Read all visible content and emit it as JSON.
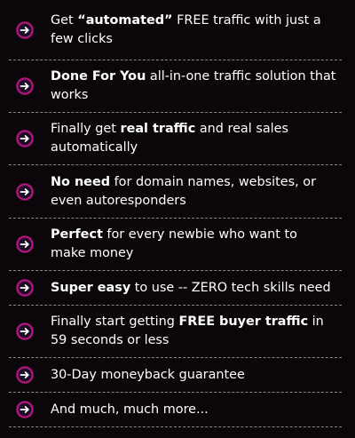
{
  "colors": {
    "background": "#0b0609",
    "text": "#ffffff",
    "bullet_ring": "#b0147c",
    "bullet_fill": "#1c0d24",
    "divider": "#8a8587"
  },
  "bullet_icon": "arrow-right-icon",
  "items": [
    {
      "pre": "Get ",
      "bold": "“automated”",
      "post": " FREE traffic with just a few clicks"
    },
    {
      "pre": "",
      "bold": " Done For You",
      "post": " all-in-one traffic solution that works"
    },
    {
      "pre": "Finally get ",
      "bold": "real traffic",
      "post": " and real sales automatically"
    },
    {
      "pre": "",
      "bold": "No need",
      "post": " for domain names, websites, or even autoresponders"
    },
    {
      "pre": "",
      "bold": "Perfect",
      "post": " for every newbie who want to make money"
    },
    {
      "pre": "",
      "bold": "Super easy",
      "post": " to use -- ZERO tech skills need"
    },
    {
      "pre": "Finally start getting ",
      "bold": "FREE buyer traffic",
      "post": " in 59 seconds or less"
    },
    {
      "pre": "30-Day moneyback guarantee",
      "bold": "",
      "post": ""
    },
    {
      "pre": "And much, much more...",
      "bold": "",
      "post": ""
    }
  ]
}
